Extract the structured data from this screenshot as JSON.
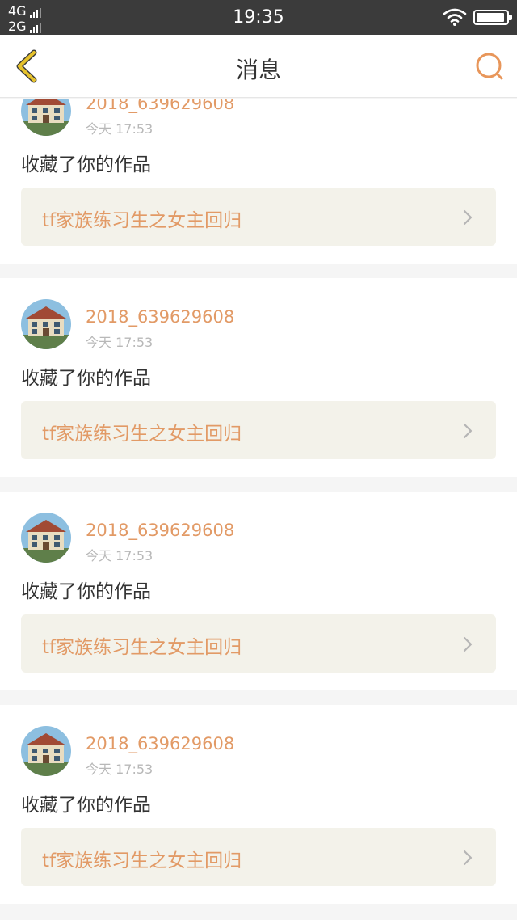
{
  "status_bar": {
    "network_1": "4G",
    "network_2": "2G",
    "time": "19:35",
    "icons": [
      "signal-icon",
      "wifi-icon",
      "battery-icon"
    ]
  },
  "nav": {
    "title": "消息",
    "back_icon": "chevron-left-icon",
    "search_icon": "search-icon"
  },
  "colors": {
    "accent": "#e29a66",
    "back_arrow": "#e6c22c",
    "card_link_bg": "#f3f2ea",
    "status_bar_bg": "#3b3b3b"
  },
  "messages": [
    {
      "username": "2018_639629608",
      "time": "今天 17:53",
      "action": "收藏了你的作品",
      "work_title": "tf家族练习生之女主回归"
    },
    {
      "username": "2018_639629608",
      "time": "今天 17:53",
      "action": "收藏了你的作品",
      "work_title": "tf家族练习生之女主回归"
    },
    {
      "username": "2018_639629608",
      "time": "今天 17:53",
      "action": "收藏了你的作品",
      "work_title": "tf家族练习生之女主回归"
    },
    {
      "username": "2018_639629608",
      "time": "今天 17:53",
      "action": "收藏了你的作品",
      "work_title": "tf家族练习生之女主回归"
    }
  ]
}
